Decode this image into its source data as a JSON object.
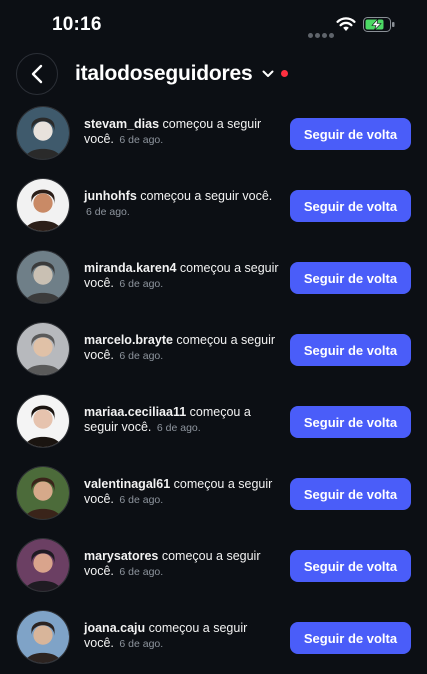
{
  "status_bar": {
    "time": "10:16"
  },
  "header": {
    "account_name": "italodoseguidores"
  },
  "notifications": [
    {
      "username": "stevam_dias",
      "before": "",
      "after": " começou a seguir você.",
      "time": "6 de ago.",
      "button_label": "Seguir de volta",
      "avatar_colors": [
        "#3f5a6c",
        "#e8e2dc",
        "#2a2a2a"
      ]
    },
    {
      "username": "junhohfs",
      "before": "",
      "after": " começou a seguir você.",
      "time": "6 de ago.",
      "button_label": "Seguir de volta",
      "avatar_colors": [
        "#f2f2f2",
        "#c98a66",
        "#2b1e18"
      ]
    },
    {
      "username": "miranda.karen4",
      "before": "",
      "after": " começou a seguir você.",
      "time": "6 de ago.",
      "button_label": "Seguir de volta",
      "avatar_colors": [
        "#6f7f88",
        "#c9c0b3",
        "#3b3b3b"
      ]
    },
    {
      "username": "marcelo.brayte",
      "before": "",
      "after": " começou a seguir você.",
      "time": "6 de ago.",
      "button_label": "Seguir de volta",
      "avatar_colors": [
        "#b7b9bd",
        "#e0c1a7",
        "#5a5a5a"
      ]
    },
    {
      "username": "mariaa.ceciliaa11",
      "before": "",
      "after": " começou a seguir você.",
      "time": "6 de ago.",
      "button_label": "Seguir de volta",
      "avatar_colors": [
        "#f4f4f4",
        "#e6c3ae",
        "#1a1410"
      ]
    },
    {
      "username": "valentinagal61",
      "before": "",
      "after": " começou a seguir você.",
      "time": "6 de ago.",
      "button_label": "Seguir de volta",
      "avatar_colors": [
        "#4c6b3a",
        "#d6a98a",
        "#3a241a"
      ]
    },
    {
      "username": "marysatores",
      "before": "",
      "after": " começou a seguir você.",
      "time": "6 de ago.",
      "button_label": "Seguir de volta",
      "avatar_colors": [
        "#6b3f63",
        "#d9a48c",
        "#1f1b22"
      ]
    },
    {
      "username": "joana.caju",
      "before": "",
      "after": " começou a seguir você.",
      "time": "6 de ago.",
      "button_label": "Seguir de volta",
      "avatar_colors": [
        "#7fa3c7",
        "#d8b59a",
        "#2c2320"
      ]
    }
  ],
  "colors": {
    "background": "#0c0f14",
    "accent": "#4a5df9",
    "notification_dot": "#ff3040"
  }
}
